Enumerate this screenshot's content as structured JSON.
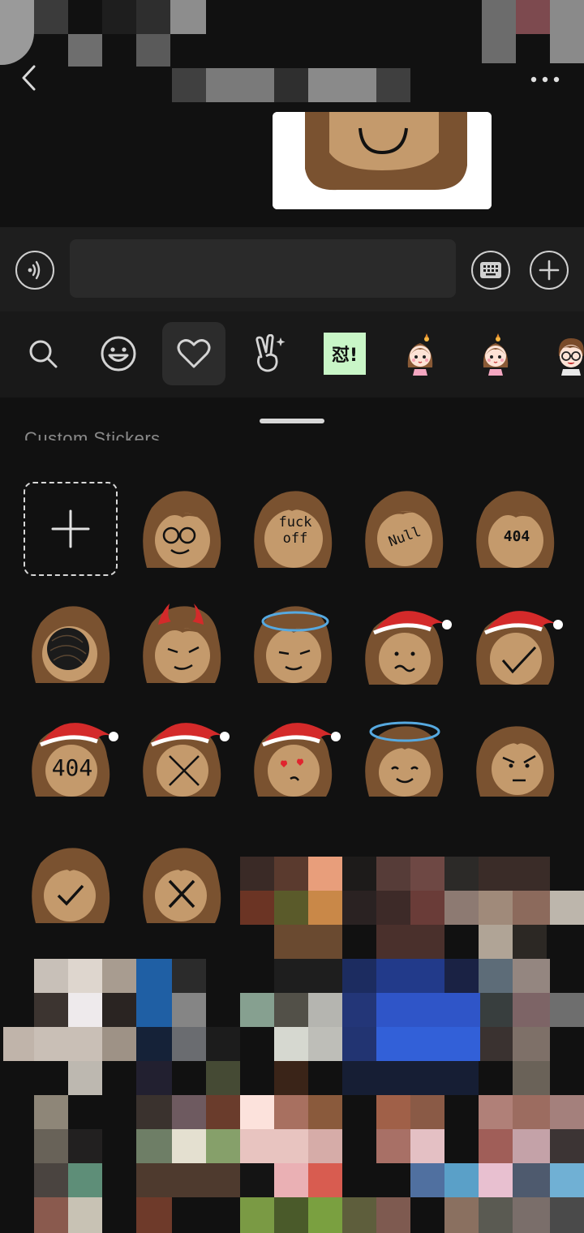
{
  "colors": {
    "background": "#111111",
    "input_bar": "#1e1e1e",
    "tab_strip": "#191919",
    "selected_tab": "#2c2c2c",
    "sticker_hair": "#7a5230",
    "sticker_face": "#c49a6c",
    "santa_hat_red": "#d42a2a",
    "halo_blue": "#56a9e0",
    "heart_red": "#e0242e"
  },
  "input": {
    "placeholder": "",
    "value": ""
  },
  "tabs": [
    {
      "icon": "search-icon",
      "selected": false
    },
    {
      "icon": "emoji-icon",
      "selected": false
    },
    {
      "icon": "heart-icon",
      "selected": true
    },
    {
      "icon": "victory-hand-icon",
      "selected": false
    },
    {
      "icon": "dui-sticker-pack-icon",
      "selected": false,
      "label": "怼!"
    },
    {
      "icon": "girl-sticker-pack-icon",
      "selected": false
    },
    {
      "icon": "girl-sticker-pack-icon",
      "selected": false
    },
    {
      "icon": "glasses-boy-sticker-pack-icon",
      "selected": false
    }
  ],
  "panel": {
    "section_title": "Custom Stickers"
  },
  "stickers": [
    {
      "name": "sticker-ooo-face"
    },
    {
      "name": "sticker-fuck-off",
      "text": "fuck\noff"
    },
    {
      "name": "sticker-null",
      "text": "Null"
    },
    {
      "name": "sticker-404",
      "text": "404"
    },
    {
      "name": "sticker-scribble-face"
    },
    {
      "name": "sticker-devil"
    },
    {
      "name": "sticker-angel-halo"
    },
    {
      "name": "sticker-santa-worried"
    },
    {
      "name": "sticker-santa-check"
    },
    {
      "name": "sticker-santa-404",
      "text": "404"
    },
    {
      "name": "sticker-santa-cross"
    },
    {
      "name": "sticker-santa-heart-eyes"
    },
    {
      "name": "sticker-angel-smile"
    },
    {
      "name": "sticker-angry"
    },
    {
      "name": "sticker-check"
    },
    {
      "name": "sticker-cross"
    }
  ]
}
